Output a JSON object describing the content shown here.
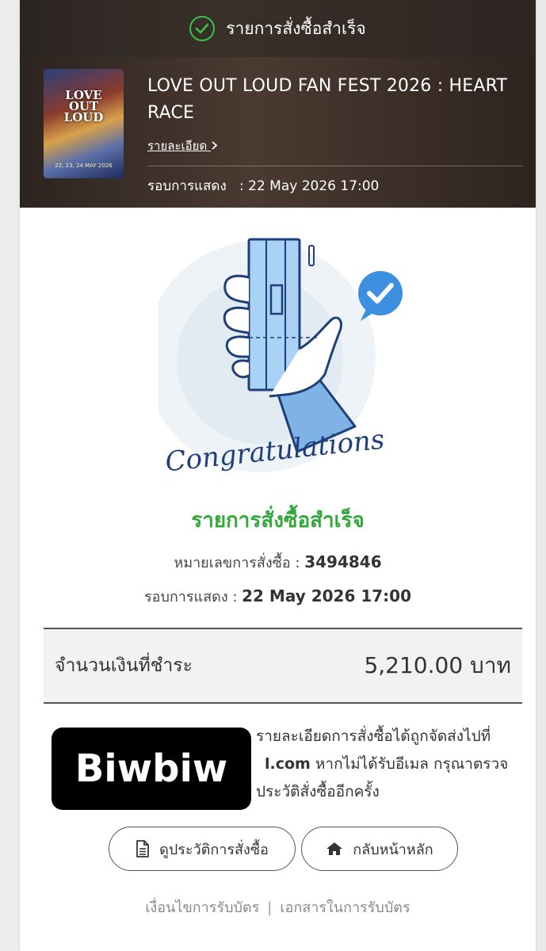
{
  "header": {
    "status_text": "รายการสั่งซื้อสำเร็จ"
  },
  "event": {
    "title": "LOVE OUT LOUD FAN FEST 2026 : HEART RACE",
    "details_link": "รายละเอียด",
    "round_label": "รอบการแสดง",
    "round_value": ": 22 May 2026 17:00",
    "poster": {
      "title_line1": "LOVE",
      "title_line2": "OUT",
      "title_line3": "LOUD",
      "date_text": "22, 23, 24 MAY 2026"
    }
  },
  "illustration": {
    "caption": "Congratulations"
  },
  "result": {
    "title": "รายการสั่งซื้อสำเร็จ",
    "order_label": "หมายเลขการสั่งซื้อ :",
    "order_number": "3494846",
    "round_label": "รอบการแสดง :",
    "round_value": "22 May 2026 17:00"
  },
  "payment": {
    "label": "จำนวนเงินที่ชำระ",
    "amount": "5,210.00 บาท"
  },
  "notice": {
    "line1": "รายละเอียดการสั่งซื้อได้ถูกจัดส่งไปที่",
    "email": "l.com",
    "line2_rest": "หากไม่ได้รับอีเมล กรุณาตรวจ",
    "line3": "ประวัติสั่งซื้ออีกครั้ง"
  },
  "watermark": {
    "text": "Biwbiw"
  },
  "buttons": {
    "history": "ดูประวัติการสั่งซื้อ",
    "home": "กลับหน้าหลัก"
  },
  "footer": {
    "terms": "เงื่อนไขการรับบัตร",
    "separator": "|",
    "documents": "เอกสารในการรับบัตร"
  },
  "colors": {
    "success_green": "#34a93b",
    "check_green": "#38c247",
    "illus_blue": "#8ec4ee",
    "caption_navy": "#1f3f7a"
  },
  "icons": [
    "check-circle-icon",
    "chevron-right-icon",
    "document-icon",
    "home-icon",
    "speech-check-icon"
  ]
}
